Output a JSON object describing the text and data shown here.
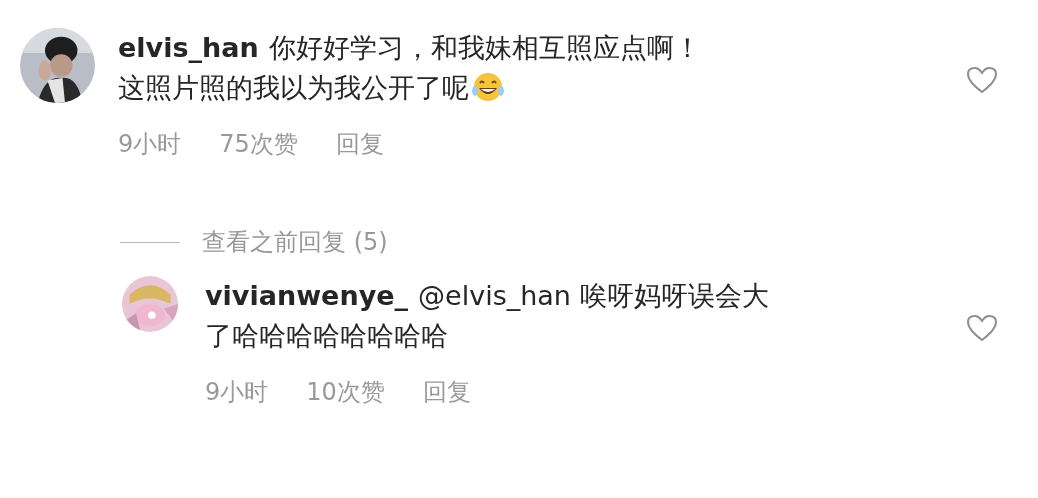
{
  "comments": [
    {
      "username": "elvis_han",
      "lines": [
        "你好好学习，和我妹相互照应点啊！",
        "这照片照的我以为我公开了呢"
      ],
      "trailing_emoji": true,
      "time": "9小时",
      "likes": "75次赞",
      "reply": "回复",
      "liked": false,
      "is_reply": false
    },
    {
      "kind": "view_replies",
      "label": "查看之前回复 (5)"
    },
    {
      "username": "vivianwenye_",
      "lines": [
        "@elvis_han 唉呀妈呀误会大",
        "了哈哈哈哈哈哈哈哈"
      ],
      "trailing_emoji": false,
      "time": "9小时",
      "likes": "10次赞",
      "reply": "回复",
      "liked": false,
      "is_reply": true
    }
  ]
}
